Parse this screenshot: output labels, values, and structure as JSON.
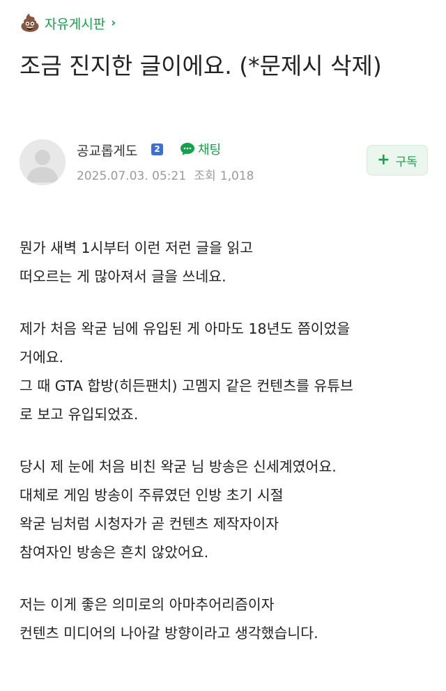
{
  "board": {
    "icon": "💩",
    "name": "자유게시판",
    "chevron": "›"
  },
  "post": {
    "title": "조금 진지한 글이에요. (*문제시 삭제)",
    "author": {
      "name": "공교롭게도",
      "level": "2",
      "chat_label": "채팅"
    },
    "date": "2025.07.03. 05:21",
    "views_label": "조회",
    "views": "1,018",
    "subscribe_label": "구독",
    "paragraphs": [
      [
        "뭔가 새벽 1시부터 이런 저런 글을 읽고",
        "떠오르는 게 많아져서 글을 쓰네요."
      ],
      [
        "제가 처음 왁굳 님에 유입된 게 아마도 18년도 쯤이었을",
        "거에요.",
        "그 때 GTA 합방(히든팬치) 고멤지 같은 컨텐츠를 유튜브",
        "로 보고 유입되었죠."
      ],
      [
        "당시 제 눈에 처음 비친 왁굳 님 방송은 신세계였어요.",
        "대체로 게임 방송이 주류였던 인방 초기 시절",
        "왁굳 님처럼 시청자가 곧 컨텐츠 제작자이자",
        "참여자인 방송은 흔치 않았어요."
      ],
      [
        "저는 이게 좋은 의미로의 아마추어리즘이자",
        "컨텐츠 미디어의 나아갈 방향이라고 생각했습니다."
      ]
    ]
  },
  "colors": {
    "accent": "#13a24a",
    "level_badge": "#3b6fd6",
    "meta": "#9a9a9a"
  },
  "icons": {
    "board": "poop-emoji-icon",
    "chat": "chat-bubble-icon",
    "avatar": "default-user-icon",
    "subscribe": "plus-icon"
  }
}
